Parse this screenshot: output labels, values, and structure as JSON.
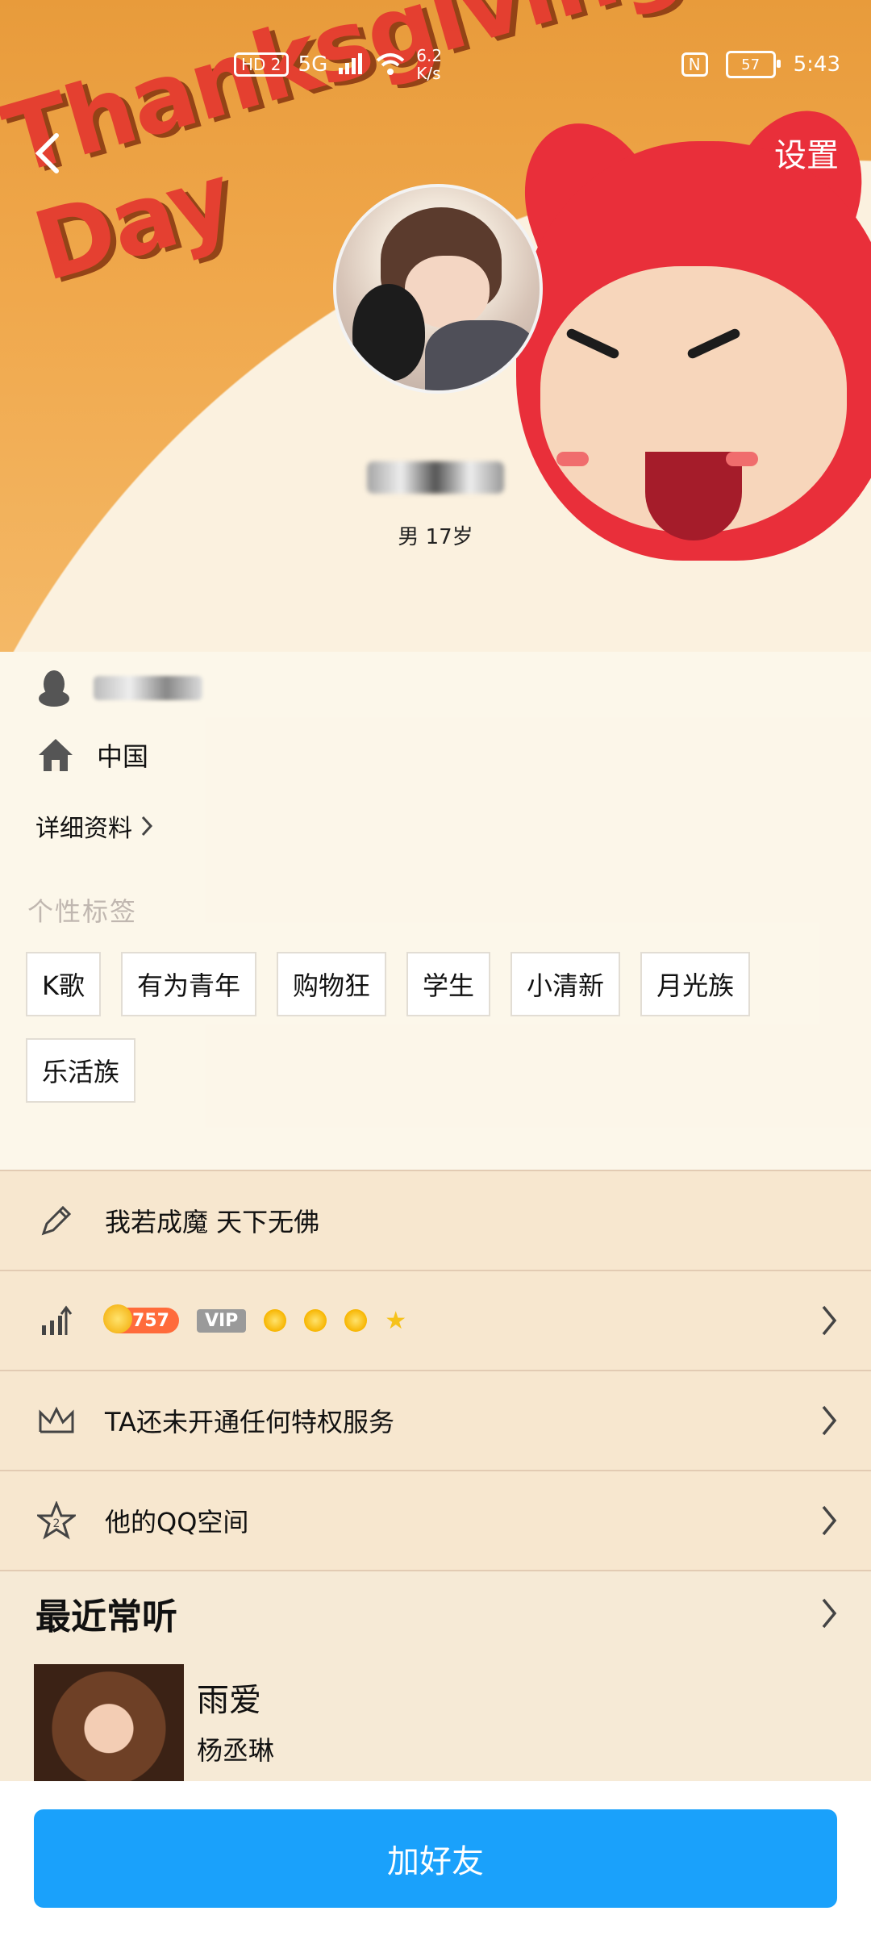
{
  "status_bar": {
    "network": "HD 2",
    "signal_5g": "5G",
    "speed": "6.2 K/s",
    "nfc": "N",
    "battery": "57",
    "time": "5:43"
  },
  "header": {
    "back_icon": "back-chevron-icon",
    "settings_label": "设置",
    "banner_text": "Thanksgiving Day",
    "gender_age": "男 17岁"
  },
  "info": {
    "qq_number_masked": "",
    "location": "中国",
    "detail_label": "详细资料"
  },
  "tags": {
    "title": "个性标签",
    "items": [
      "K歌",
      "有为青年",
      "购物狂",
      "学生",
      "小清新",
      "月光族",
      "乐活族"
    ]
  },
  "rows": {
    "signature": "我若成魔 天下无佛",
    "level_value": "757",
    "vip_label": "VIP",
    "privilege": "TA还未开通任何特权服务",
    "qzone": "他的QQ空间"
  },
  "recent": {
    "title": "最近常听",
    "song_title": "雨爱",
    "song_artist": "杨丞琳"
  },
  "footer": {
    "add_friend": "加好友"
  },
  "colors": {
    "primary_button": "#1aa1fb",
    "level_badge": "#ff6b3b",
    "banner_orange": "#f0a84c"
  }
}
